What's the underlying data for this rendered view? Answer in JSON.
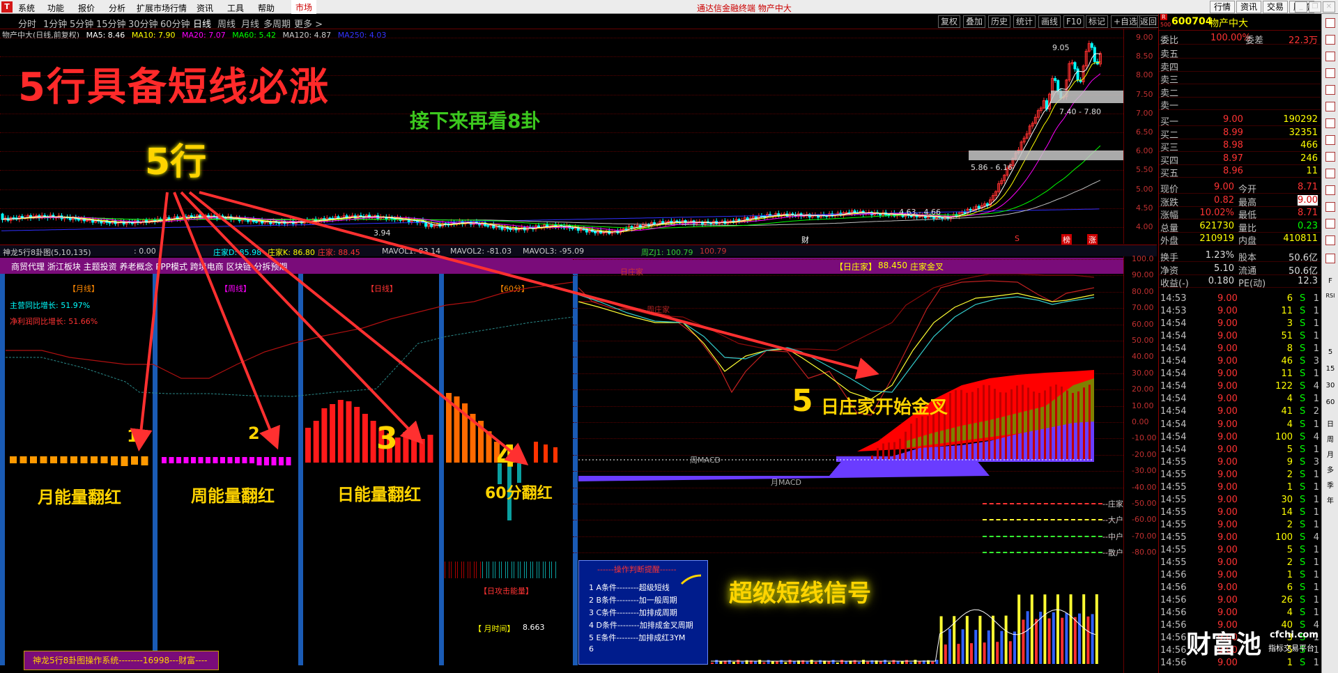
{
  "menubar": {
    "logo": "T",
    "items": [
      "系统",
      "功能",
      "报价",
      "分析",
      "扩展市场行情",
      "资讯",
      "工具",
      "帮助"
    ],
    "market": "市场",
    "title": "通达信金融终端  物产中大",
    "right_buttons": [
      "行情",
      "资讯",
      "交易",
      "服务"
    ],
    "win": [
      "_",
      "❐",
      "✕"
    ]
  },
  "periods": [
    "分时",
    "1分钟",
    "5分钟",
    "15分钟",
    "30分钟",
    "60分钟",
    "日线",
    "周线",
    "月线",
    "多周期",
    "更多 >"
  ],
  "right_tools": [
    "复权",
    "叠加",
    "历史",
    "统计",
    "画线",
    "F10",
    "标记",
    "+自选",
    "返回"
  ],
  "ma_line": {
    "name": "物产中大(日线,前复权)",
    "ma5": "MA5: 8.46",
    "ma10": "MA10: 7.90",
    "ma20": "MA20: 7.07",
    "ma60": "MA60: 5.42",
    "ma120": "MA120: 4.87",
    "ma250": "MA250: 4.03"
  },
  "colors": {
    "ma5": "#ffffff",
    "ma10": "#ffff00",
    "ma20": "#ff00ff",
    "ma60": "#00ff00",
    "ma120": "#c0c0c0",
    "ma250": "#3030ff",
    "up": "#ff3030",
    "down": "#00ffff"
  },
  "price_axis": [
    "9.00",
    "8.50",
    "8.00",
    "7.50",
    "7.00",
    "6.50",
    "6.00",
    "5.50",
    "5.00",
    "4.50",
    "4.00"
  ],
  "chart_labels": {
    "high": "9.05",
    "low": "3.94",
    "range1": "7.40 - 7.80",
    "range2": "5.86 - 6.16",
    "range3": "4.63 - 4.66",
    "mark_cai": "财",
    "mark_s": "S",
    "mark_bang": "榜",
    "mark_zhang": "涨"
  },
  "annotations": {
    "headline": "5行具备短线必涨",
    "next": "接下来再看8卦",
    "five": "5行",
    "n1": "1",
    "n2": "2",
    "n3": "3",
    "n4": "4",
    "month": "月能量翻红",
    "week": "周能量翻红",
    "day": "日能量翻红",
    "min60": "60分翻红",
    "n5": "5",
    "golden": "日庄家开始金叉",
    "super": "超级短线信号"
  },
  "indicator_bar": {
    "name": "神龙5行8卦图(5,10,135)",
    "val": ": 0.00",
    "zjd": "庄家D: 85.98",
    "zjk": "庄家K: 86.80",
    "zj": "庄家: 88.45",
    "mavol1": "MAVOL1: 83.14",
    "mavol2": "MAVOL2: -81.03",
    "mavol3": "MAVOL3: -95.09",
    "zj1": "周ZJ1: 100.79",
    "zj1v": "100.79"
  },
  "concept_bar": {
    "text": "商贸代理 浙江板块 主题投资 养老概念 PPP模式 跨境电商 区块链 分拆预期",
    "tag": "【日庄家】",
    "val": "88.450",
    "cross": "庄家金叉"
  },
  "panel_titles": {
    "month": "【月线】",
    "week": "【周线】",
    "day": "【日线】",
    "min60": "【60分】",
    "rz": "日庄家",
    "zj": "周庄家"
  },
  "growth": {
    "rev": "主营同比增长: 51.97%",
    "profit": "净利润同比增长: 51.66%"
  },
  "macd": {
    "week": "周MACD",
    "month": "月MACD"
  },
  "legend": [
    "--庄家",
    "--大户",
    "--中户",
    "--散户"
  ],
  "lower_axis": [
    "100.0",
    "90.00",
    "80.00",
    "70.00",
    "60.00",
    "50.00",
    "40.00",
    "30.00",
    "20.00",
    "10.00",
    "0.00",
    "-10.00",
    "-20.00",
    "-30.00",
    "-40.00",
    "-50.00",
    "-60.00",
    "-70.00",
    "-80.00"
  ],
  "energy": {
    "label": "【日攻击能量】",
    "time_label": "【 月时间】",
    "time_val": "8.663"
  },
  "signal_box": {
    "title": "------操作判断提醒------",
    "rows": [
      "1  A条件--------超级短线",
      "2  B条件--------加一般周期",
      "3  C条件--------加排成周期",
      "4  D条件--------加排成金叉周期",
      "5  E条件--------加排成红3YM",
      "6"
    ]
  },
  "bottom_title": "神龙5行8卦图操作系统--------16998---财富----",
  "quote": {
    "code": "600704",
    "name": "物产中大",
    "r": "R",
    "r2": "500",
    "wb": [
      "委比",
      "100.00%",
      "委差",
      "22.3万"
    ],
    "sells": [
      [
        "卖五",
        "",
        ""
      ],
      [
        "卖四",
        "",
        ""
      ],
      [
        "卖三",
        "",
        ""
      ],
      [
        "卖二",
        "",
        ""
      ],
      [
        "卖一",
        "",
        ""
      ]
    ],
    "buys": [
      [
        "买一",
        "9.00",
        "190292"
      ],
      [
        "买二",
        "8.99",
        "32351"
      ],
      [
        "买三",
        "8.98",
        "466"
      ],
      [
        "买四",
        "8.97",
        "246"
      ],
      [
        "买五",
        "8.96",
        "11"
      ]
    ],
    "stats": [
      [
        "现价",
        "9.00",
        "今开",
        "8.71"
      ],
      [
        "涨跌",
        "0.82",
        "最高",
        "9.00"
      ],
      [
        "涨幅",
        "10.02%",
        "最低",
        "8.71"
      ],
      [
        "总量",
        "621730",
        "量比",
        "0.23"
      ],
      [
        "外盘",
        "210919",
        "内盘",
        "410811"
      ]
    ],
    "stats2": [
      [
        "换手",
        "1.23%",
        "股本",
        "50.6亿"
      ],
      [
        "净资",
        "5.10",
        "流通",
        "50.6亿"
      ],
      [
        "收益(-)",
        "0.180",
        "PE(动)",
        "12.3"
      ]
    ]
  },
  "ticks": [
    [
      "14:53",
      "9.00",
      "6",
      "S",
      "1"
    ],
    [
      "14:53",
      "9.00",
      "11",
      "S",
      "1"
    ],
    [
      "14:54",
      "9.00",
      "3",
      "S",
      "1"
    ],
    [
      "14:54",
      "9.00",
      "51",
      "S",
      "1"
    ],
    [
      "14:54",
      "9.00",
      "8",
      "S",
      "1"
    ],
    [
      "14:54",
      "9.00",
      "46",
      "S",
      "3"
    ],
    [
      "14:54",
      "9.00",
      "11",
      "S",
      "1"
    ],
    [
      "14:54",
      "9.00",
      "122",
      "S",
      "4"
    ],
    [
      "14:54",
      "9.00",
      "4",
      "S",
      "1"
    ],
    [
      "14:54",
      "9.00",
      "41",
      "S",
      "2"
    ],
    [
      "14:54",
      "9.00",
      "4",
      "S",
      "1"
    ],
    [
      "14:54",
      "9.00",
      "100",
      "S",
      "4"
    ],
    [
      "14:54",
      "9.00",
      "5",
      "S",
      "1"
    ],
    [
      "14:55",
      "9.00",
      "9",
      "S",
      "3"
    ],
    [
      "14:55",
      "9.00",
      "2",
      "S",
      "1"
    ],
    [
      "14:55",
      "9.00",
      "1",
      "S",
      "1"
    ],
    [
      "14:55",
      "9.00",
      "30",
      "S",
      "1"
    ],
    [
      "14:55",
      "9.00",
      "14",
      "S",
      "1"
    ],
    [
      "14:55",
      "9.00",
      "2",
      "S",
      "1"
    ],
    [
      "14:55",
      "9.00",
      "100",
      "S",
      "4"
    ],
    [
      "14:55",
      "9.00",
      "5",
      "S",
      "1"
    ],
    [
      "14:55",
      "9.00",
      "2",
      "S",
      "1"
    ],
    [
      "14:56",
      "9.00",
      "1",
      "S",
      "1"
    ],
    [
      "14:56",
      "9.00",
      "6",
      "S",
      "1"
    ],
    [
      "14:56",
      "9.00",
      "26",
      "S",
      "1"
    ],
    [
      "14:56",
      "9.00",
      "4",
      "S",
      "1"
    ],
    [
      "14:56",
      "9.00",
      "40",
      "S",
      "4"
    ],
    [
      "14:56",
      "9.00",
      "3",
      "S",
      "1"
    ],
    [
      "14:56",
      "9.00",
      "5",
      "S",
      "1"
    ],
    [
      "14:56",
      "9.00",
      "1",
      "S",
      "1"
    ]
  ],
  "watermark": {
    "name": "财富池",
    "url": "cfchi.com",
    "sub": "指标交易平台"
  },
  "sidebar": [
    "F",
    "RSI",
    "日",
    "周",
    "月",
    "多",
    "季",
    "年",
    "5",
    "15",
    "30",
    "60"
  ]
}
